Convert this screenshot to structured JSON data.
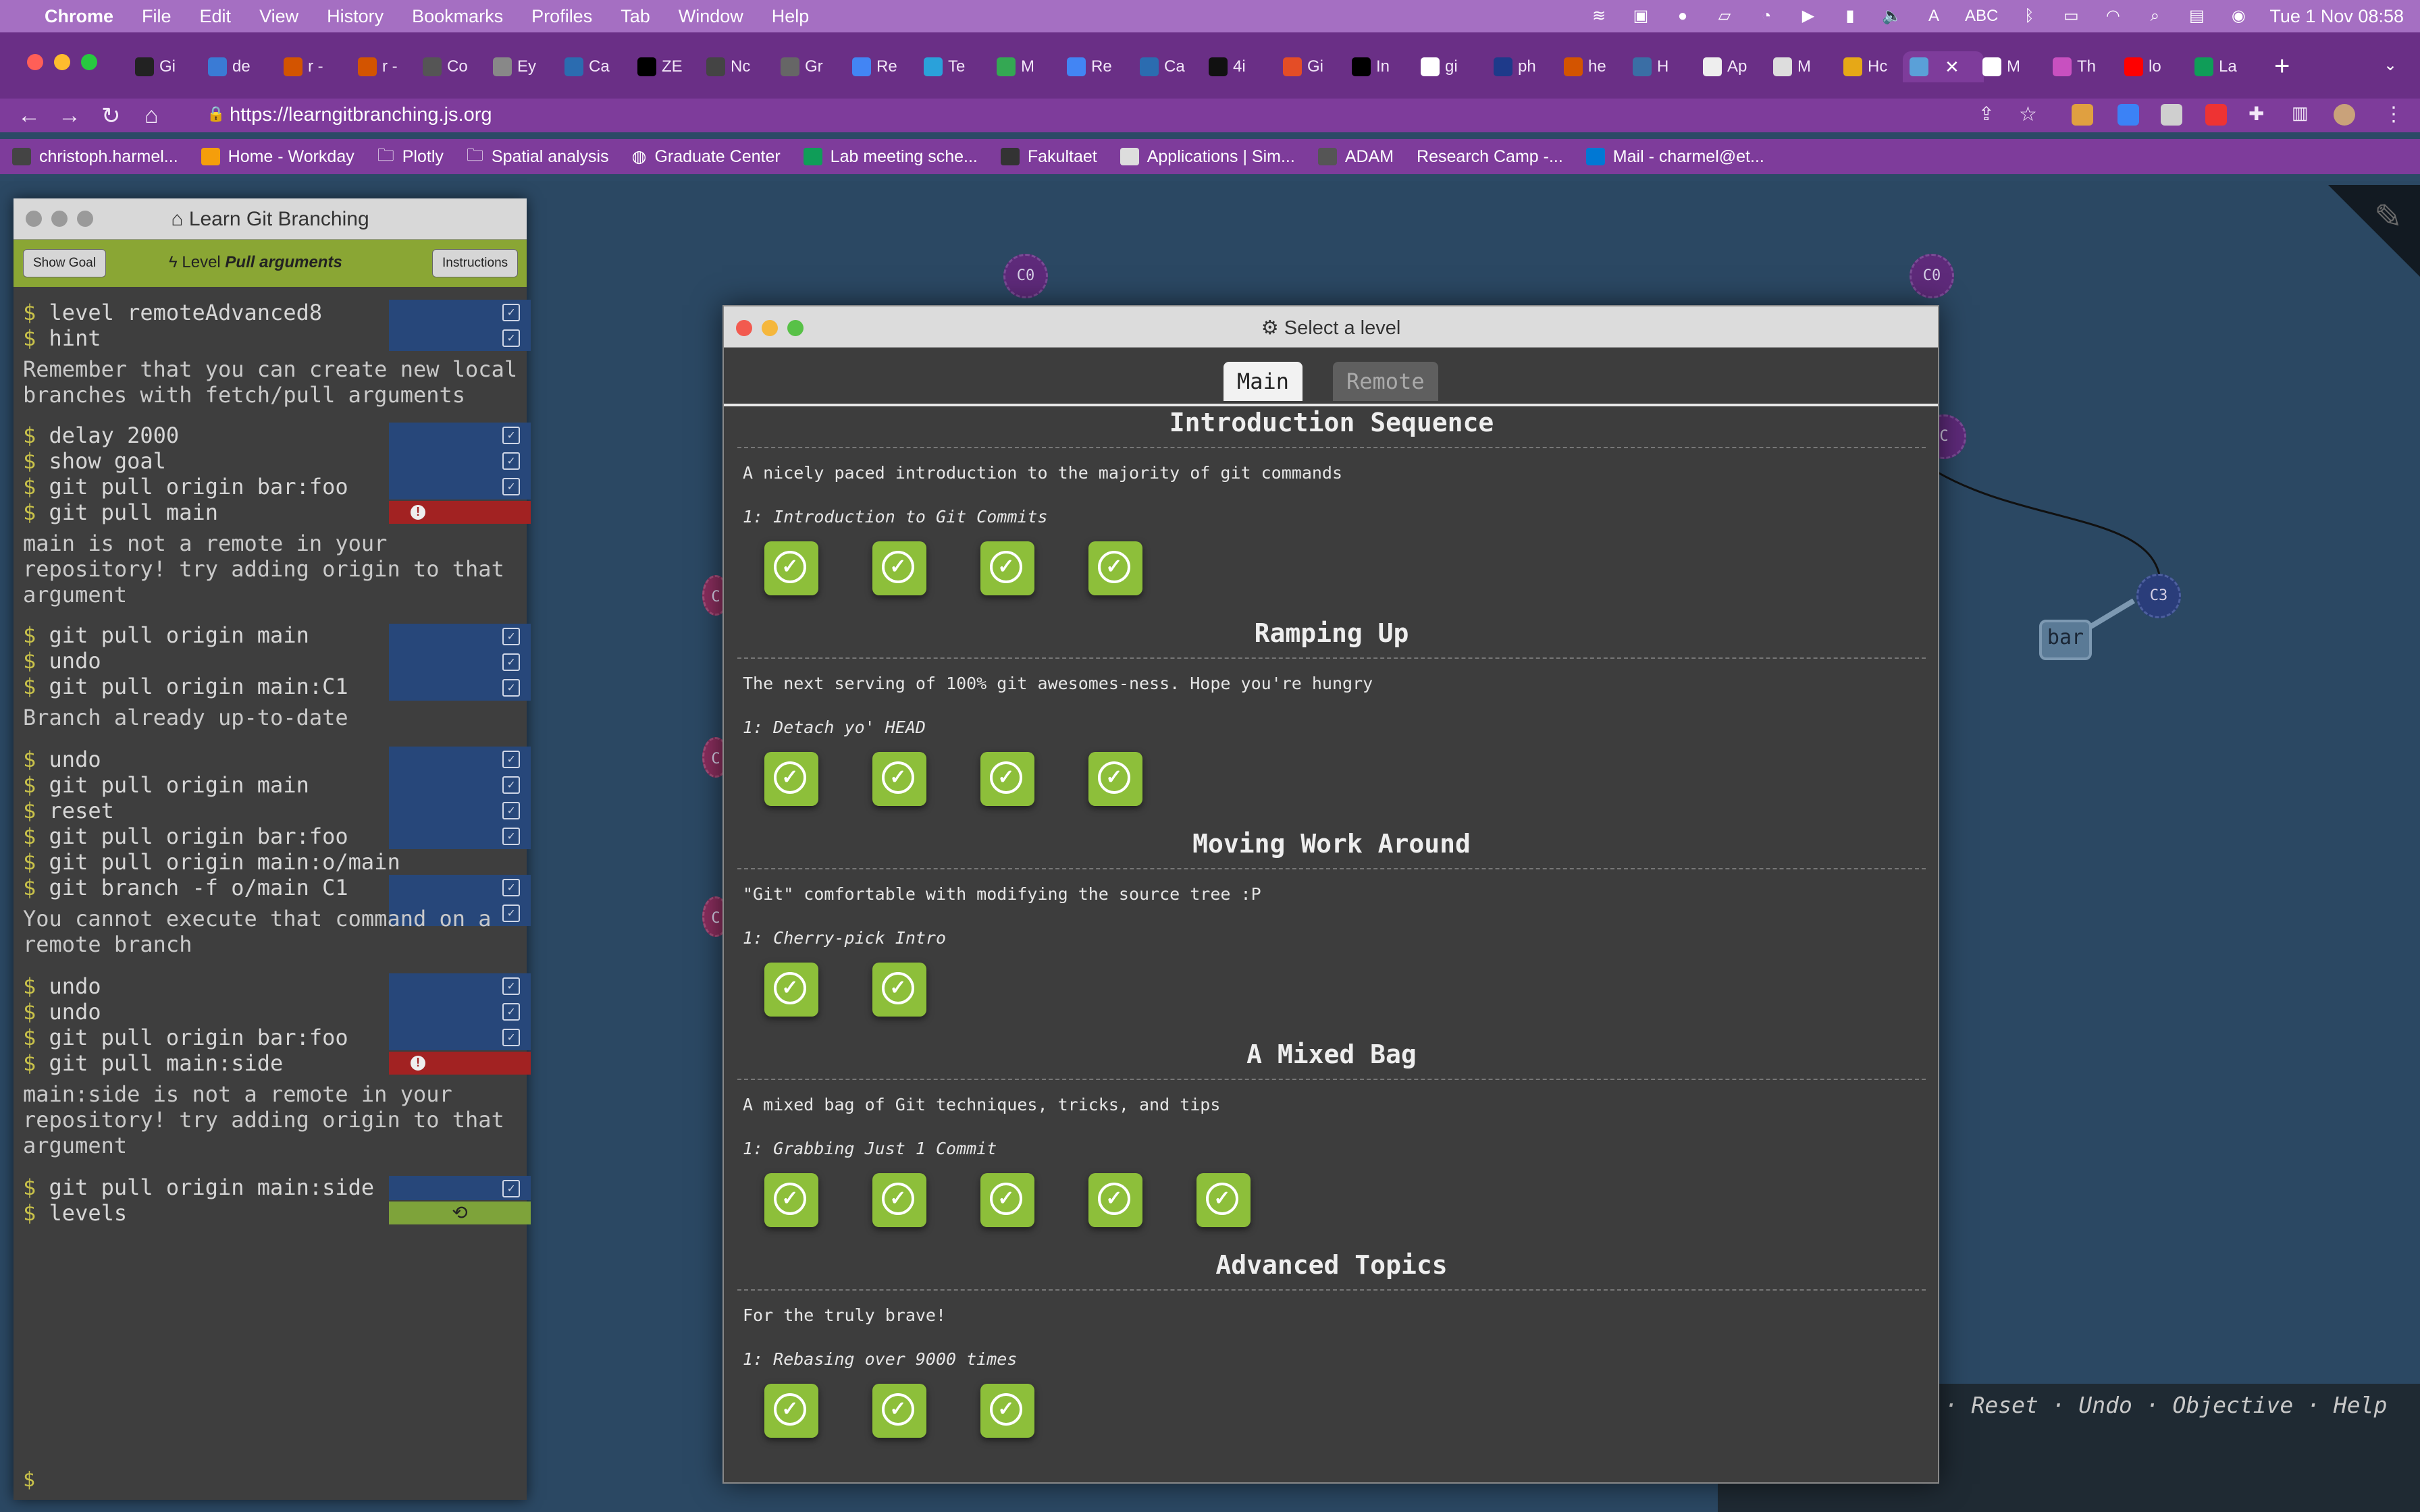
{
  "menubar": {
    "app": "Chrome",
    "items": [
      "File",
      "Edit",
      "View",
      "History",
      "Bookmarks",
      "Profiles",
      "Tab",
      "Window",
      "Help"
    ],
    "input_source": "ABC",
    "datetime": "Tue 1 Nov  08:58"
  },
  "tabs": [
    {
      "label": "Gi"
    },
    {
      "label": "de"
    },
    {
      "label": "r -"
    },
    {
      "label": "r -"
    },
    {
      "label": "Co"
    },
    {
      "label": "Ey"
    },
    {
      "label": "Ca"
    },
    {
      "label": "ZE"
    },
    {
      "label": "Nc"
    },
    {
      "label": "Gr"
    },
    {
      "label": "Re"
    },
    {
      "label": "Te"
    },
    {
      "label": "M"
    },
    {
      "label": "Re"
    },
    {
      "label": "Ca"
    },
    {
      "label": "4i"
    },
    {
      "label": "Gi"
    },
    {
      "label": "In"
    },
    {
      "label": "gi"
    },
    {
      "label": "ph"
    },
    {
      "label": "he"
    },
    {
      "label": "H"
    },
    {
      "label": "Ap"
    },
    {
      "label": "M"
    },
    {
      "label": "Hc"
    },
    {
      "label": ""
    },
    {
      "label": "M"
    },
    {
      "label": "Th"
    },
    {
      "label": "lo"
    },
    {
      "label": "La"
    }
  ],
  "toolbar": {
    "url": "https://learngitbranching.js.org"
  },
  "bookmarks": [
    {
      "label": "christoph.harmel..."
    },
    {
      "label": "Home - Workday"
    },
    {
      "label": "Plotly"
    },
    {
      "label": "Spatial analysis"
    },
    {
      "label": "Graduate Center"
    },
    {
      "label": "Lab meeting sche..."
    },
    {
      "label": "Fakultaet"
    },
    {
      "label": "Applications | Sim..."
    },
    {
      "label": "ADAM"
    },
    {
      "label": "Research Camp -..."
    },
    {
      "label": "Mail - charmel@et..."
    }
  ],
  "cmdpanel": {
    "title": "Learn Git Branching",
    "show_goal": "Show Goal",
    "instructions": "Instructions",
    "level_prefix": "Level",
    "level_name": "Pull arguments",
    "commands": [
      "level remoteAdvanced8",
      "hint",
      "Remember that you can create new local branches with fetch/pull arguments",
      "delay 2000",
      "show goal",
      "git pull origin bar:foo",
      "git pull main",
      "main is not a remote in your repository! try adding origin to that argument",
      "git pull origin main",
      "undo",
      "git pull origin main:C1",
      "Branch already up-to-date",
      "undo",
      "git pull origin main",
      "reset",
      "git pull origin bar:foo",
      "git pull origin main:o/main",
      "git branch -f o/main C1",
      "You cannot execute that command on a remote branch",
      "undo",
      "undo",
      "git pull origin bar:foo",
      "git pull main:side",
      "main:side is not a remote in your repository! try adding origin to that argument",
      "git pull origin main:side",
      "levels"
    ],
    "prompt": "$"
  },
  "tree": {
    "c0_left": "C0",
    "c0_right": "C0",
    "c3": "C3",
    "bar": "bar",
    "c_a": "C",
    "c_b": "C",
    "c_c": "C",
    "c_top": "C"
  },
  "bottom_links": "n · Reset · Undo · Objective · Help",
  "modal": {
    "title": "Select a level",
    "tab_main": "Main",
    "tab_remote": "Remote",
    "sequences": [
      {
        "title": "Introduction Sequence",
        "about": "A nicely paced introduction to the majority of git commands",
        "sub": "1: Introduction to Git Commits",
        "count": 4
      },
      {
        "title": "Ramping Up",
        "about": "The next serving of 100% git awesomes-ness. Hope you're hungry",
        "sub": "1: Detach yo' HEAD",
        "count": 4
      },
      {
        "title": "Moving Work Around",
        "about": "\"Git\" comfortable with modifying the source tree :P",
        "sub": "1: Cherry-pick Intro",
        "count": 2
      },
      {
        "title": "A Mixed Bag",
        "about": "A mixed bag of Git techniques, tricks, and tips",
        "sub": "1: Grabbing Just 1 Commit",
        "count": 5
      },
      {
        "title": "Advanced Topics",
        "about": "For the truly brave!",
        "sub": "1: Rebasing over 9000 times",
        "count": 3
      }
    ]
  },
  "colors": {
    "menubar": "#a56fc2",
    "tabstrip": "#6a2f86",
    "toolbar": "#7e3c9b",
    "level_complete": "#8dbf3a",
    "page_bg": "#2b4863"
  }
}
